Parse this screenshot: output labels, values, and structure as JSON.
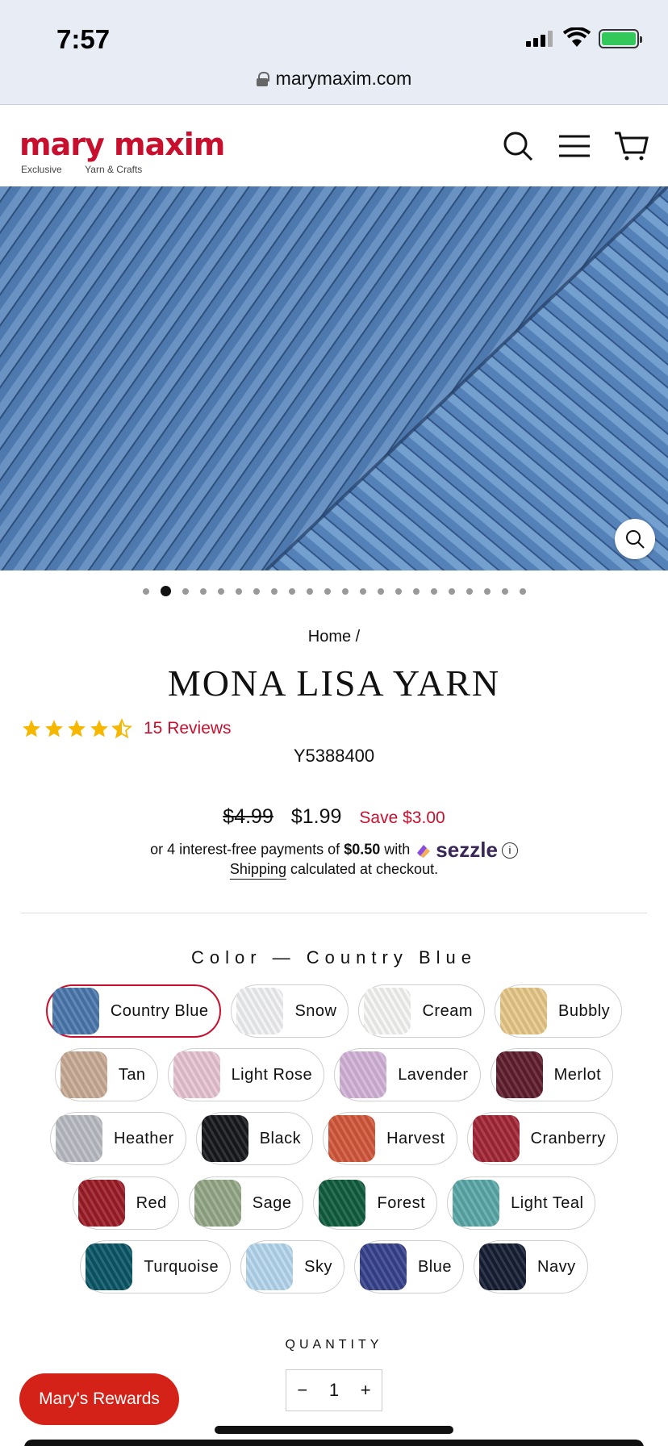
{
  "status_bar": {
    "time": "7:57"
  },
  "browser": {
    "url": "marymaxim.com"
  },
  "header": {
    "logo_text": "mary maxim",
    "logo_sub_left": "Exclusive",
    "logo_sub_right": "Yarn & Crafts",
    "icons": [
      "search-icon",
      "menu-icon",
      "cart-icon"
    ]
  },
  "carousel": {
    "dot_count": 22,
    "active_index": 1
  },
  "breadcrumb": "Home /",
  "product": {
    "title": "MONA LISA YARN",
    "rating": 4.5,
    "reviews_label": "15 Reviews",
    "sku": "Y5388400",
    "old_price": "$4.99",
    "price": "$1.99",
    "save": "Save $3.00",
    "installments_prefix": "or 4 interest-free payments of",
    "installment_amount": "$0.50",
    "installments_with": "with",
    "sezzle": "sezzle",
    "info": "i",
    "shipping_link": "Shipping",
    "shipping_suffix": "calculated at checkout."
  },
  "color": {
    "label": "Color — Country Blue",
    "rows": [
      [
        {
          "name": "Country Blue",
          "hex": "#4b77ad",
          "selected": true
        },
        {
          "name": "Snow",
          "hex": "#f2f3f5"
        },
        {
          "name": "Cream",
          "hex": "#f6f6f4"
        },
        {
          "name": "Bubbly",
          "hex": "#e7c889"
        }
      ],
      [
        {
          "name": "Tan",
          "hex": "#c9ab96"
        },
        {
          "name": "Light Rose",
          "hex": "#e8c4d3"
        },
        {
          "name": "Lavender",
          "hex": "#d3b3d8"
        },
        {
          "name": "Merlot",
          "hex": "#5e1d2c"
        }
      ],
      [
        {
          "name": "Heather",
          "hex": "#b9bcc2"
        },
        {
          "name": "Black",
          "hex": "#17181c"
        },
        {
          "name": "Harvest",
          "hex": "#d1573a"
        },
        {
          "name": "Cranberry",
          "hex": "#a32636"
        }
      ],
      [
        {
          "name": "Red",
          "hex": "#9c1c27"
        },
        {
          "name": "Sage",
          "hex": "#94a787"
        },
        {
          "name": "Forest",
          "hex": "#0f5c3e"
        },
        {
          "name": "Light Teal",
          "hex": "#5aa7a8"
        }
      ],
      [
        {
          "name": "Turquoise",
          "hex": "#0a5665"
        },
        {
          "name": "Sky",
          "hex": "#b5d6ee"
        },
        {
          "name": "Blue",
          "hex": "#36418c"
        },
        {
          "name": "Navy",
          "hex": "#151d33"
        }
      ]
    ]
  },
  "quantity": {
    "label": "QUANTITY",
    "minus": "−",
    "value": "1",
    "plus": "+"
  },
  "rewards_button": "Mary's Rewards",
  "colors": {
    "brand": "#c8102e",
    "rewards": "#d42218"
  }
}
